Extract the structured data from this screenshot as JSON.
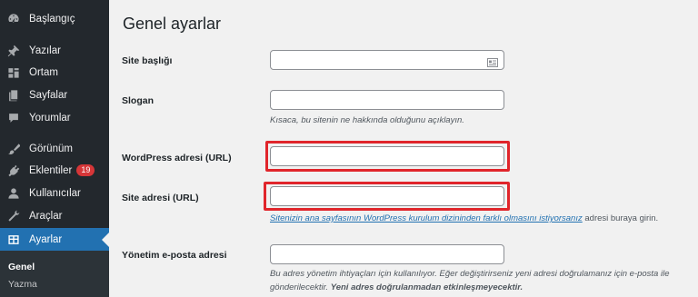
{
  "sidebar": {
    "items": [
      {
        "label": "Başlangıç",
        "icon": "dashboard-icon"
      },
      {
        "label": "Yazılar",
        "icon": "pin-icon"
      },
      {
        "label": "Ortam",
        "icon": "media-icon"
      },
      {
        "label": "Sayfalar",
        "icon": "pages-icon"
      },
      {
        "label": "Yorumlar",
        "icon": "comments-icon"
      },
      {
        "label": "Görünüm",
        "icon": "appearance-icon"
      },
      {
        "label": "Eklentiler",
        "icon": "plugins-icon",
        "badge": "19"
      },
      {
        "label": "Kullanıcılar",
        "icon": "users-icon"
      },
      {
        "label": "Araçlar",
        "icon": "tools-icon"
      },
      {
        "label": "Ayarlar",
        "icon": "settings-icon",
        "active": true
      }
    ],
    "submenu": [
      {
        "label": "Genel",
        "current": true
      },
      {
        "label": "Yazma"
      }
    ]
  },
  "main": {
    "title": "Genel ayarlar",
    "fields": {
      "site_title": {
        "label": "Site başlığı",
        "value": ""
      },
      "tagline": {
        "label": "Slogan",
        "value": "",
        "description": "Kısaca, bu sitenin ne hakkında olduğunu açıklayın."
      },
      "wp_url": {
        "label": "WordPress adresi (URL)",
        "value": ""
      },
      "site_url": {
        "label": "Site adresi (URL)",
        "value": "",
        "description_link": "Sitenizin ana sayfasının WordPress kurulum dizininden farklı olmasını istiyorsanız",
        "description_rest": " adresi buraya girin."
      },
      "admin_email": {
        "label": "Yönetim e-posta adresi",
        "value": "",
        "description_line1": "Bu adres yönetim ihtiyaçları için kullanılıyor. Eğer değiştirirseniz yeni adresi doğrulamanız için e-posta ile",
        "description_line2a": "gönderilecektir. ",
        "description_line2b": "Yeni adres doğrulanmadan etkinleşmeyecektir."
      }
    }
  },
  "colors": {
    "sidebar_bg": "#23282d",
    "active_bg": "#2271b1",
    "badge_bg": "#d63638",
    "highlight": "#e0252b",
    "link": "#2271b1"
  }
}
